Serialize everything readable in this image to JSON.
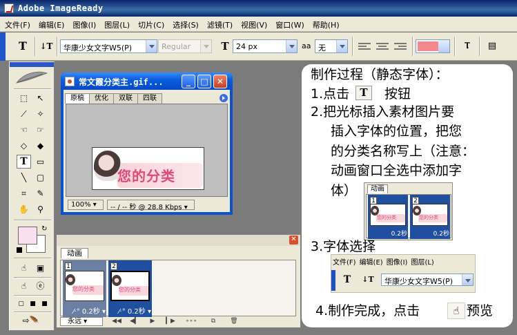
{
  "window": {
    "title": "Adobe ImageReady"
  },
  "menu": [
    "文件(F)",
    "编辑(E)",
    "图像(I)",
    "图层(L)",
    "切片(C)",
    "选择(S)",
    "滤镜(T)",
    "视图(V)",
    "窗口(W)",
    "帮助(H)"
  ],
  "options": {
    "font_family": "华康少女文字W5(P)",
    "font_style": "Regular",
    "font_size": "24 px",
    "aa_label": "aa",
    "aa_mode": "无",
    "text_color": "#f4888f"
  },
  "document": {
    "title": "常文霞分类主.gif...",
    "tabs": [
      "原稿",
      "优化",
      "双联",
      "四联"
    ],
    "zoom": "100%",
    "status": "-- / -- 秒 @ 28.8 Kbps",
    "image_text": "您的分类"
  },
  "animation": {
    "tab": "动画",
    "frames": [
      {
        "number": "1",
        "delay": "0.2秒"
      },
      {
        "number": "2",
        "delay": "0.2秒"
      }
    ],
    "loop": "永远",
    "thumb_text": "您的分类"
  },
  "instructions": {
    "title": "制作过程（静态字体）：",
    "step1_a": "1.点击",
    "step1_icon": "T",
    "step1_b": "按钮",
    "step2_lines": [
      "2.把光标插入素材图片要",
      "插入字体的位置，把您",
      "的分类名称写上（注意：",
      "动画窗口全选中添加字",
      "体）"
    ],
    "step3": "3.字体选择",
    "step3_menu": [
      "文件(F)",
      "编辑(E)",
      "图像(I)",
      "图层(L)"
    ],
    "step3_font": "华康少女文字W5(P)",
    "step4_a": "4.制作完成，点击",
    "step4_b": "预览"
  }
}
